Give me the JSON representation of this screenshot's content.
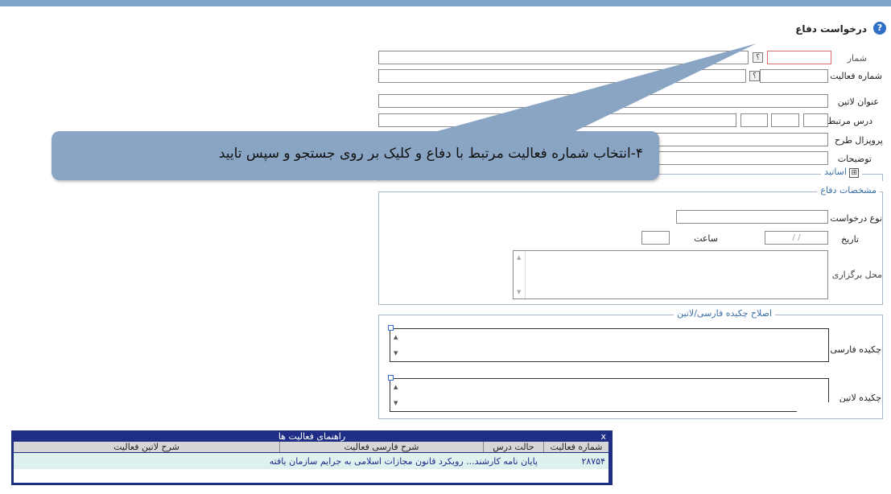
{
  "header": {
    "title": "درخواست دفاع"
  },
  "form": {
    "activity_no_label": "شماره فعالیت",
    "latin_title_label": "عنوان لاتین",
    "related_course_label": "درس مرتبط",
    "proposal_label": "پروپزال طرح",
    "description_label": "توضیحات",
    "professors_label": "اساتید",
    "professors_toggle": "⊞",
    "defense_specs_legend": "مشخصات دفاع",
    "request_type_label": "نوع درخواست",
    "date_label": "تاریخ",
    "date_placeholder": "/   /",
    "time_label": "ساعت",
    "venue_label": "محل برگزاری",
    "abstract_legend": "اصلاح چکیده فارسی/لاتین",
    "persian_abstract_label": "چکیده فارسی",
    "latin_abstract_label": "چکیده لاتین",
    "help_btn": "؟"
  },
  "callout": {
    "text": "۴-انتخاب شماره فعالیت مرتبط با دفاع و کلیک بر روی جستجو و سپس تایید"
  },
  "activity_help": {
    "title": "راهنمای فعالیت ها",
    "close": "x",
    "columns": [
      "شماره فعالیت",
      "حالت درس",
      "شرح فارسی فعالیت",
      "شرح لاتین فعالیت"
    ],
    "rows": [
      {
        "number": "۲۸۷۵۴",
        "state": "",
        "persian_desc": "پایان نامه کارشند... رویکرد قانون مجازات اسلامی به جرایم سازمان یافته",
        "latin_desc": ""
      }
    ]
  }
}
